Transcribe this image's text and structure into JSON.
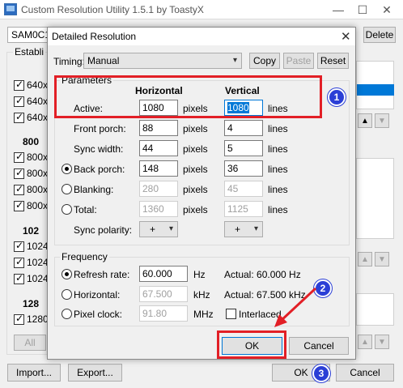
{
  "window": {
    "title": "Custom Resolution Utility 1.5.1 by ToastyX"
  },
  "main": {
    "monitor": "SAM0C18",
    "delete_label": "Delete",
    "establ_label": "Establi",
    "modes": [
      "640x",
      "640x",
      "640x",
      "800",
      "800x",
      "800x",
      "800x",
      "800x",
      "102",
      "1024",
      "1024",
      "1024",
      "128",
      "1280"
    ],
    "all_label": "All",
    "import_label": "Import...",
    "export_label": "Export...",
    "ok_label": "OK",
    "cancel_label": "Cancel"
  },
  "dialog": {
    "title": "Detailed Resolution",
    "timing_label": "Timing:",
    "timing_value": "Manual",
    "copy_label": "Copy",
    "paste_label": "Paste",
    "reset_label": "Reset",
    "parameters_label": "Parameters",
    "horizontal_header": "Horizontal",
    "vertical_header": "Vertical",
    "rows": [
      {
        "label": "Active:",
        "h": "1080",
        "hunit": "pixels",
        "v": "1080",
        "vunit": "lines"
      },
      {
        "label": "Front porch:",
        "h": "88",
        "hunit": "pixels",
        "v": "4",
        "vunit": "lines"
      },
      {
        "label": "Sync width:",
        "h": "44",
        "hunit": "pixels",
        "v": "5",
        "vunit": "lines"
      },
      {
        "label": "Back porch:",
        "h": "148",
        "hunit": "pixels",
        "v": "36",
        "vunit": "lines"
      },
      {
        "label": "Blanking:",
        "h": "280",
        "hunit": "pixels",
        "v": "45",
        "vunit": "lines"
      },
      {
        "label": "Total:",
        "h": "1360",
        "hunit": "pixels",
        "v": "1125",
        "vunit": "lines"
      }
    ],
    "sync_polarity_label": "Sync polarity:",
    "sync_h": "+",
    "sync_v": "+",
    "frequency_label": "Frequency",
    "refresh_label": "Refresh rate:",
    "refresh_value": "60.000",
    "refresh_unit": "Hz",
    "refresh_actual": "Actual: 60.000 Hz",
    "horizontal_label": "Horizontal:",
    "horizontal_value": "67.500",
    "horizontal_unit": "kHz",
    "horizontal_actual": "Actual: 67.500 kHz",
    "pixelclock_label": "Pixel clock:",
    "pixelclock_value": "91.80",
    "pixelclock_unit": "MHz",
    "interlaced_label": "Interlaced",
    "ok_label": "OK",
    "cancel_label": "Cancel"
  },
  "annotations": {
    "badge1": "1",
    "badge2": "2",
    "badge3": "3",
    "accent": "#e21f26",
    "badge_color": "#2b3fd6"
  }
}
